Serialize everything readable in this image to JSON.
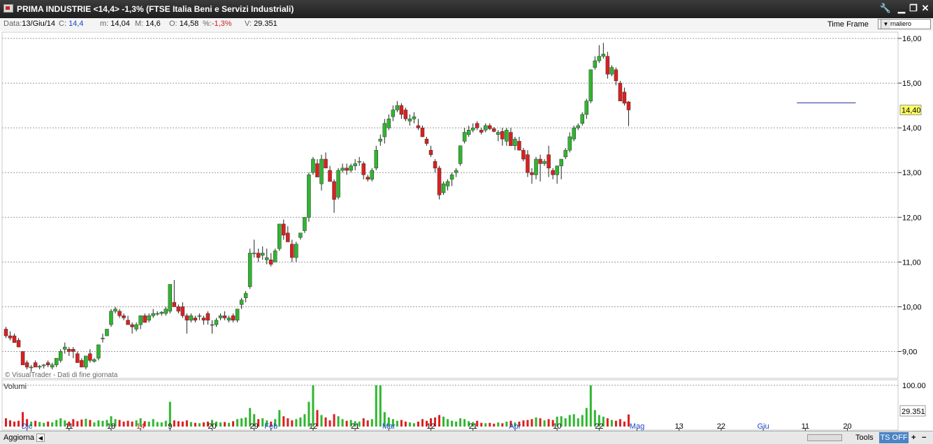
{
  "window": {
    "title": "PRIMA INDUSTRIE <14,4> -1,3%  (FTSE Italia Beni e Servizi Industriali)",
    "buttons": [
      "🔧",
      "▁",
      "❐",
      "✕"
    ]
  },
  "infobar": {
    "date_label": "Data:",
    "date_value": "13/Giu/14",
    "close_label": "C:",
    "close_value": "14,4",
    "min_label": "m:",
    "min_value": "14,04",
    "max_label": "M:",
    "max_value": "14,6",
    "open_label": "O:",
    "open_value": "14,58",
    "pct_label": "%:",
    "pct_value": "-1,3%",
    "vol_label": "V:",
    "vol_value": "29.351",
    "timeframe_label": "Time Frame",
    "timeframe_value": "Giornaliero"
  },
  "watermark": "© VisualTrader - Dati di fine giornata",
  "volume_panel": {
    "label": "Volumi",
    "last_value": "29.351"
  },
  "last_price": "14,40",
  "bottombar": {
    "update": "Aggiorna",
    "tools": "Tools",
    "ts": "TS OFF",
    "plus": "+",
    "minus": "−"
  },
  "colors": {
    "up": "#2fb62f",
    "down": "#dc1f1f",
    "grid": "#9a9a9a",
    "price_line": "#1c2a9e",
    "ts_button": "#4b83c4"
  },
  "chart_data": {
    "type": "candlestick",
    "price_axis": {
      "min": 8.5,
      "max": 16.0,
      "ticks": [
        9,
        10,
        11,
        12,
        13,
        14,
        15,
        16
      ],
      "tick_labels": [
        "9,00",
        "10,00",
        "11,00",
        "12,00",
        "13,00",
        "14,00",
        "15,00",
        "16,00"
      ]
    },
    "volume_axis": {
      "max": 110000,
      "ticks": [
        100000
      ],
      "tick_labels": [
        "100.00"
      ]
    },
    "x_labels": [
      {
        "label": "Dic",
        "index": 5,
        "color": "#1a46c8"
      },
      {
        "label": "11",
        "index": 15
      },
      {
        "label": "18",
        "index": 25
      },
      {
        "label": "14",
        "index": 32,
        "color": "#d02020"
      },
      {
        "label": "9",
        "index": 39
      },
      {
        "label": "20",
        "index": 49
      },
      {
        "label": "29",
        "index": 59
      },
      {
        "label": "Feb",
        "index": 63,
        "color": "#1a46c8"
      },
      {
        "label": "12",
        "index": 73
      },
      {
        "label": "21",
        "index": 83
      },
      {
        "label": "Mar",
        "index": 91,
        "color": "#1a46c8"
      },
      {
        "label": "12",
        "index": 101
      },
      {
        "label": "21",
        "index": 111
      },
      {
        "label": "Apr",
        "index": 121,
        "color": "#1a46c8"
      },
      {
        "label": "10",
        "index": 131
      },
      {
        "label": "22",
        "index": 141
      },
      {
        "label": "Mag",
        "index": 150,
        "color": "#1a46c8"
      },
      {
        "label": "13",
        "index": 160
      },
      {
        "label": "22",
        "index": 170
      },
      {
        "label": "Giu",
        "index": 180,
        "color": "#1a46c8"
      },
      {
        "label": "11",
        "index": 190
      },
      {
        "label": "20",
        "index": 200
      }
    ],
    "current_price": 14.56,
    "current_line_from_index": 188,
    "current_line_to_index": 202,
    "ohlcv": [
      [
        9.5,
        9.55,
        9.3,
        9.35,
        20000
      ],
      [
        9.35,
        9.45,
        9.25,
        9.3,
        15000
      ],
      [
        9.35,
        9.4,
        9.2,
        9.2,
        12000
      ],
      [
        9.25,
        9.3,
        9.1,
        9.1,
        14000
      ],
      [
        9.0,
        9.0,
        8.7,
        8.7,
        35000
      ],
      [
        8.75,
        8.8,
        8.6,
        8.65,
        18000
      ],
      [
        8.65,
        8.7,
        8.55,
        8.65,
        12000
      ],
      [
        8.75,
        8.8,
        8.65,
        8.65,
        14000
      ],
      [
        8.65,
        8.7,
        8.6,
        8.67,
        11000
      ],
      [
        8.68,
        8.72,
        8.62,
        8.7,
        9000
      ],
      [
        8.75,
        8.8,
        8.65,
        8.7,
        12000
      ],
      [
        8.65,
        8.75,
        8.6,
        8.7,
        10000
      ],
      [
        8.7,
        8.85,
        8.65,
        8.85,
        16000
      ],
      [
        8.8,
        9.05,
        8.75,
        9.0,
        20000
      ],
      [
        9.05,
        9.2,
        8.95,
        9.1,
        15000
      ],
      [
        9.05,
        9.1,
        8.9,
        9.0,
        12000
      ],
      [
        9.05,
        9.1,
        8.85,
        9.0,
        18000
      ],
      [
        8.95,
        9.0,
        8.75,
        8.75,
        13000
      ],
      [
        8.8,
        8.85,
        8.65,
        8.65,
        17000
      ],
      [
        8.65,
        8.9,
        8.6,
        8.9,
        19000
      ],
      [
        8.95,
        9.05,
        8.75,
        8.8,
        16000
      ],
      [
        8.78,
        8.85,
        8.75,
        8.82,
        10000
      ],
      [
        8.85,
        9.15,
        8.8,
        9.15,
        15000
      ],
      [
        9.3,
        9.4,
        9.2,
        9.3,
        14000
      ],
      [
        9.35,
        9.5,
        9.35,
        9.5,
        16000
      ],
      [
        9.6,
        9.95,
        9.55,
        9.9,
        25000
      ],
      [
        9.9,
        10.0,
        9.85,
        9.95,
        18000
      ],
      [
        9.9,
        9.95,
        9.75,
        9.8,
        16000
      ],
      [
        9.8,
        9.85,
        9.7,
        9.75,
        12000
      ],
      [
        9.7,
        9.8,
        9.6,
        9.6,
        14000
      ],
      [
        9.6,
        9.65,
        9.4,
        9.55,
        12000
      ],
      [
        9.5,
        9.65,
        9.45,
        9.6,
        15000
      ],
      [
        9.6,
        9.8,
        9.5,
        9.8,
        20000
      ],
      [
        9.8,
        9.85,
        9.65,
        9.65,
        13000
      ],
      [
        9.7,
        9.85,
        9.65,
        9.8,
        12000
      ],
      [
        9.8,
        9.95,
        9.75,
        9.85,
        18000
      ],
      [
        9.85,
        9.9,
        9.8,
        9.85,
        11000
      ],
      [
        9.85,
        9.9,
        9.8,
        9.88,
        10000
      ],
      [
        9.85,
        10.0,
        9.8,
        9.95,
        14000
      ],
      [
        9.9,
        10.5,
        9.85,
        10.5,
        60000
      ],
      [
        10.1,
        10.6,
        10.0,
        10.0,
        15000
      ],
      [
        10.0,
        10.05,
        9.85,
        9.9,
        13000
      ],
      [
        10.0,
        10.1,
        9.75,
        9.8,
        12000
      ],
      [
        9.8,
        9.85,
        9.4,
        9.7,
        15000
      ],
      [
        9.7,
        9.85,
        9.65,
        9.8,
        11000
      ],
      [
        9.75,
        9.8,
        9.65,
        9.7,
        9000
      ],
      [
        9.8,
        9.85,
        9.7,
        9.8,
        8000
      ],
      [
        9.75,
        9.8,
        9.6,
        9.7,
        10000
      ],
      [
        9.85,
        9.9,
        9.6,
        9.7,
        12000
      ],
      [
        9.6,
        9.7,
        9.4,
        9.6,
        16000
      ],
      [
        9.6,
        9.75,
        9.55,
        9.7,
        12000
      ],
      [
        9.75,
        9.85,
        9.7,
        9.8,
        10000
      ],
      [
        9.8,
        9.9,
        9.7,
        9.75,
        11000
      ],
      [
        9.7,
        9.8,
        9.65,
        9.75,
        9000
      ],
      [
        9.8,
        9.85,
        9.65,
        9.7,
        13000
      ],
      [
        9.7,
        9.95,
        9.65,
        9.95,
        18000
      ],
      [
        10.05,
        10.2,
        9.95,
        10.15,
        20000
      ],
      [
        10.2,
        10.35,
        10.1,
        10.3,
        22000
      ],
      [
        10.45,
        11.3,
        10.4,
        11.2,
        45000
      ],
      [
        11.2,
        11.5,
        11.1,
        11.2,
        30000
      ],
      [
        11.2,
        11.3,
        11.0,
        11.1,
        18000
      ],
      [
        11.15,
        11.35,
        11.05,
        11.2,
        20000
      ],
      [
        11.05,
        11.3,
        10.95,
        11.1,
        15000
      ],
      [
        11.05,
        11.2,
        10.9,
        10.95,
        12000
      ],
      [
        11.0,
        11.3,
        11.0,
        11.25,
        18000
      ],
      [
        11.3,
        11.85,
        11.25,
        11.85,
        40000
      ],
      [
        11.85,
        11.95,
        11.5,
        11.6,
        25000
      ],
      [
        11.65,
        11.8,
        11.45,
        11.45,
        20000
      ],
      [
        11.4,
        11.5,
        11.0,
        11.1,
        15000
      ],
      [
        11.1,
        11.45,
        11.0,
        11.4,
        18000
      ],
      [
        11.55,
        11.65,
        11.5,
        11.65,
        22000
      ],
      [
        11.7,
        12.0,
        11.65,
        12.0,
        30000
      ],
      [
        12.0,
        13.0,
        11.9,
        12.95,
        60000
      ],
      [
        13.0,
        13.35,
        12.95,
        13.3,
        100000
      ],
      [
        13.2,
        13.3,
        12.9,
        12.9,
        40000
      ],
      [
        12.75,
        13.4,
        12.6,
        13.3,
        28000
      ],
      [
        13.3,
        13.45,
        13.1,
        13.1,
        22000
      ],
      [
        13.05,
        13.15,
        12.85,
        12.8,
        15000
      ],
      [
        12.8,
        12.85,
        12.1,
        12.4,
        30000
      ],
      [
        12.45,
        13.1,
        12.4,
        13.05,
        25000
      ],
      [
        13.05,
        13.2,
        13.0,
        13.1,
        18000
      ],
      [
        13.1,
        13.2,
        12.95,
        13.05,
        14000
      ],
      [
        13.05,
        13.2,
        13.0,
        13.15,
        16000
      ],
      [
        13.15,
        13.3,
        13.05,
        13.2,
        13000
      ],
      [
        13.25,
        13.35,
        13.15,
        13.25,
        12000
      ],
      [
        13.2,
        13.25,
        12.85,
        12.95,
        20000
      ],
      [
        12.9,
        12.95,
        12.8,
        12.85,
        15000
      ],
      [
        12.85,
        13.1,
        12.8,
        13.05,
        18000
      ],
      [
        13.1,
        13.6,
        13.05,
        13.5,
        100000
      ],
      [
        13.7,
        13.85,
        13.6,
        13.75,
        100000
      ],
      [
        13.8,
        14.2,
        13.65,
        14.1,
        35000
      ],
      [
        14.0,
        14.3,
        13.95,
        14.2,
        22000
      ],
      [
        14.25,
        14.5,
        14.15,
        14.4,
        18000
      ],
      [
        14.4,
        14.6,
        14.35,
        14.5,
        14000
      ],
      [
        14.5,
        14.55,
        14.2,
        14.3,
        16000
      ],
      [
        14.4,
        14.45,
        14.15,
        14.2,
        12000
      ],
      [
        14.15,
        14.3,
        14.05,
        14.2,
        10000
      ],
      [
        14.2,
        14.35,
        14.1,
        14.25,
        8000
      ],
      [
        14.05,
        14.2,
        13.95,
        14.0,
        12000
      ],
      [
        14.0,
        14.05,
        13.8,
        13.8,
        18000
      ],
      [
        13.75,
        13.8,
        13.6,
        13.65,
        14000
      ],
      [
        13.5,
        13.6,
        13.35,
        13.4,
        20000
      ],
      [
        13.25,
        13.3,
        13.0,
        13.1,
        22000
      ],
      [
        13.1,
        13.15,
        12.4,
        12.5,
        28000
      ],
      [
        12.55,
        12.8,
        12.5,
        12.75,
        24000
      ],
      [
        12.7,
        12.85,
        12.6,
        12.8,
        18000
      ],
      [
        12.85,
        13.0,
        12.7,
        12.95,
        14000
      ],
      [
        13.0,
        13.1,
        12.9,
        13.05,
        12000
      ],
      [
        13.2,
        13.6,
        13.15,
        13.6,
        20000
      ],
      [
        13.7,
        14.0,
        13.65,
        13.9,
        18000
      ],
      [
        13.85,
        14.05,
        13.8,
        13.95,
        13000
      ],
      [
        13.95,
        14.1,
        13.9,
        14.0,
        11000
      ],
      [
        14.1,
        14.15,
        13.95,
        14.0,
        14000
      ],
      [
        13.95,
        14.0,
        13.85,
        13.9,
        9000
      ],
      [
        13.95,
        14.1,
        13.9,
        14.05,
        8000
      ],
      [
        14.05,
        14.1,
        13.95,
        13.98,
        9000
      ],
      [
        13.98,
        14.02,
        13.9,
        13.92,
        7000
      ],
      [
        13.85,
        13.95,
        13.7,
        13.9,
        10000
      ],
      [
        13.92,
        14.0,
        13.6,
        13.75,
        8000
      ],
      [
        13.7,
        14.0,
        13.6,
        13.95,
        12000
      ],
      [
        13.9,
        14.0,
        13.6,
        13.6,
        14000
      ],
      [
        13.6,
        13.8,
        13.5,
        13.75,
        10000
      ],
      [
        13.7,
        13.8,
        13.5,
        13.5,
        12000
      ],
      [
        13.5,
        13.55,
        13.25,
        13.3,
        15000
      ],
      [
        13.4,
        13.5,
        12.9,
        13.0,
        16000
      ],
      [
        13.0,
        13.1,
        12.75,
        12.95,
        18000
      ],
      [
        12.95,
        13.35,
        12.85,
        13.3,
        22000
      ],
      [
        13.3,
        13.4,
        12.8,
        13.2,
        20000
      ],
      [
        13.2,
        13.3,
        13.15,
        13.25,
        15000
      ],
      [
        13.4,
        13.6,
        12.9,
        13.1,
        18000
      ],
      [
        13.05,
        13.1,
        12.85,
        12.95,
        16000
      ],
      [
        12.95,
        13.15,
        12.75,
        13.15,
        24000
      ],
      [
        13.15,
        13.25,
        12.85,
        13.3,
        25000
      ],
      [
        13.35,
        13.55,
        13.3,
        13.5,
        20000
      ],
      [
        13.5,
        13.9,
        13.45,
        13.8,
        28000
      ],
      [
        13.75,
        14.05,
        13.7,
        14.0,
        30000
      ],
      [
        14.0,
        14.1,
        13.95,
        14.05,
        20000
      ],
      [
        14.1,
        14.35,
        14.05,
        14.3,
        28000
      ],
      [
        14.3,
        14.65,
        14.2,
        14.6,
        45000
      ],
      [
        14.6,
        15.3,
        14.55,
        15.3,
        100000
      ],
      [
        15.35,
        15.6,
        15.3,
        15.5,
        40000
      ],
      [
        15.5,
        15.85,
        15.45,
        15.6,
        28000
      ],
      [
        15.6,
        15.9,
        15.55,
        15.65,
        24000
      ],
      [
        15.6,
        15.7,
        15.1,
        15.2,
        20000
      ],
      [
        15.2,
        15.4,
        15.15,
        15.35,
        16000
      ],
      [
        15.3,
        15.35,
        14.95,
        15.05,
        14000
      ],
      [
        15.0,
        15.05,
        14.6,
        14.6,
        18000
      ],
      [
        14.8,
        14.9,
        14.5,
        14.55,
        12000
      ],
      [
        14.58,
        14.6,
        14.04,
        14.4,
        29351
      ]
    ]
  }
}
